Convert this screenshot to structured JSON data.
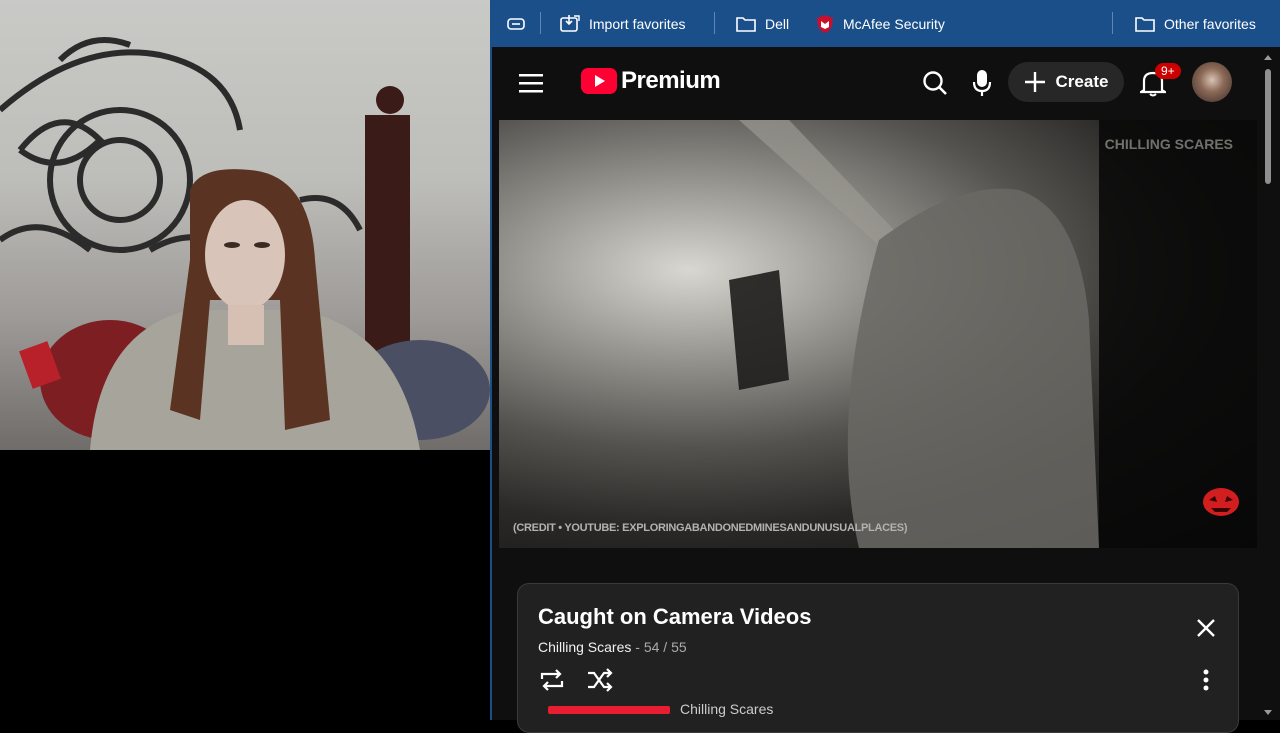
{
  "favorites_bar": {
    "items": [
      {
        "label": "Import favorites",
        "icon": "import-icon"
      },
      {
        "label": "Dell",
        "icon": "folder-icon"
      },
      {
        "label": "McAfee Security",
        "icon": "mcafee-shield-icon"
      },
      {
        "label": "Other favorites",
        "icon": "folder-icon"
      }
    ]
  },
  "youtube": {
    "logo_text": "Premium",
    "create_label": "Create",
    "notification_badge": "9+"
  },
  "video": {
    "watermark": "CHILLING SCARES",
    "credit": "(CREDIT • YOUTUBE: EXPLORINGABANDONEDMINESANDUNUSUALPLACES)"
  },
  "playlist": {
    "title": "Caught on Camera Videos",
    "channel": "Chilling Scares",
    "position": "54 / 55",
    "next_channel": "Chilling Scares"
  },
  "colors": {
    "favbar": "#1b4f8a",
    "youtube_red": "#ff0033",
    "panel": "#212121"
  }
}
